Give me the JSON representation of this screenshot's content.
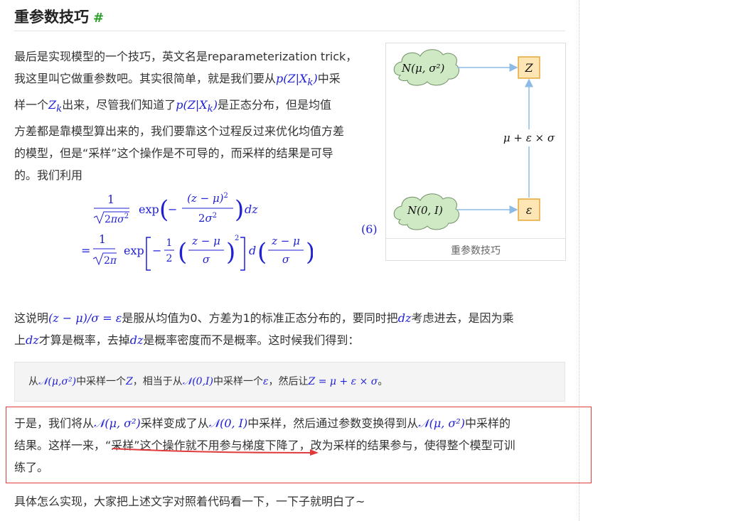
{
  "section": {
    "title": "重参数技巧",
    "anchor": "#"
  },
  "intro": {
    "t1": "最后是实现模型的一个技巧，英文名是reparameterization trick，",
    "t2": "我这里叫它做重参数吧。其实很简单，就是我们要从",
    "m1": "p(Z|X",
    "m1sub": "k",
    "m1end": ")",
    "t3": "中采",
    "t4": "样一个",
    "m2": "Z",
    "m2sub": "k",
    "t5": "出来，尽管我们知道了",
    "m3": "p(Z|X",
    "m3sub": "k",
    "m3end": ")",
    "t6": "是正态分布，但是均值",
    "t7": "方差都是靠模型算出来的，我们要靠这个过程反过来优化均值方差",
    "t8": "的模型，但是“采样”这个操作是不可导的，而采样的结果是可导",
    "t9": "的。我们利用"
  },
  "figure": {
    "cloud_top": "N(μ, σ²)",
    "cloud_bottom": "N(0, I)",
    "box_top": "Z",
    "box_bottom": "ε",
    "edge_label": "μ + ε × σ",
    "caption": "重参数技巧",
    "cloud_fill": "#cfe9c4",
    "box_fill": "#fde6b4",
    "box_stroke": "#e3a93a",
    "arrow": "#8dbbe6"
  },
  "equation": {
    "number": "(6)"
  },
  "para2": {
    "t1": "这说明",
    "m1": "(z − μ)/σ = ε",
    "t2": "是服从均值为0、方差为1的标准正态分布的，要同时把",
    "m2": "dz",
    "t3": "考虑进去，是因为乘",
    "t4": "上",
    "m3": "dz",
    "t5": "才算是概率，去掉",
    "m4": "dz",
    "t6": "是概率密度而不是概率。这时候我们得到："
  },
  "quote": {
    "t1": "从",
    "m1": "𝒩(μ,σ²)",
    "t2": "中采样一个",
    "m2": "Z",
    "t3": "，相当于从",
    "m3": "𝒩(0,I)",
    "t4": "中采样一个",
    "m4": "ε",
    "t5": "，然后让",
    "m5": "Z = μ + ε × σ",
    "t6": "。"
  },
  "para3": {
    "t1": "于是，我们将从",
    "m1": "𝒩(μ, σ²)",
    "t2": "采样变成了从",
    "m2": "𝒩(0, I)",
    "t3": "中采样，然后通过参数变换得到从",
    "m3": "𝒩(μ, σ²)",
    "t4": "中采样的",
    "t5": "结果。这样一来，“采样”这个操作就不用参与梯度下降了，改为采样的结果参与，使得整个模型可训",
    "t6": "练了。"
  },
  "para4": {
    "text": "具体怎么实现，大家把上述文字对照着代码看一下，一下子就明白了~"
  },
  "colors": {
    "math": "#1f1fd6",
    "highlight": "#e03b3b",
    "anchor": "#2a9d2a"
  }
}
